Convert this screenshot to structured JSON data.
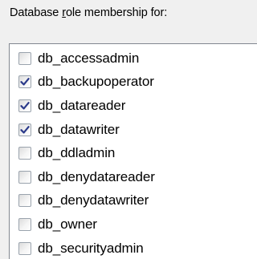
{
  "header": {
    "label_pre": "Database ",
    "label_mnemonic": "r",
    "label_post": "ole membership for:"
  },
  "role_list": {
    "items": [
      {
        "label": "db_accessadmin",
        "checked": false
      },
      {
        "label": "db_backupoperator",
        "checked": true
      },
      {
        "label": "db_datareader",
        "checked": true
      },
      {
        "label": "db_datawriter",
        "checked": true
      },
      {
        "label": "db_ddladmin",
        "checked": false
      },
      {
        "label": "db_denydatareader",
        "checked": false
      },
      {
        "label": "db_denydatawriter",
        "checked": false
      },
      {
        "label": "db_owner",
        "checked": false
      },
      {
        "label": "db_securityadmin",
        "checked": false
      }
    ]
  },
  "colors": {
    "check_mark": "#2b3a8a",
    "checkbox_border": "#9aa3ad",
    "list_background": "#ffffff",
    "window_background": "#f0f0f0"
  },
  "icons": {
    "check": "check-mark-icon"
  }
}
